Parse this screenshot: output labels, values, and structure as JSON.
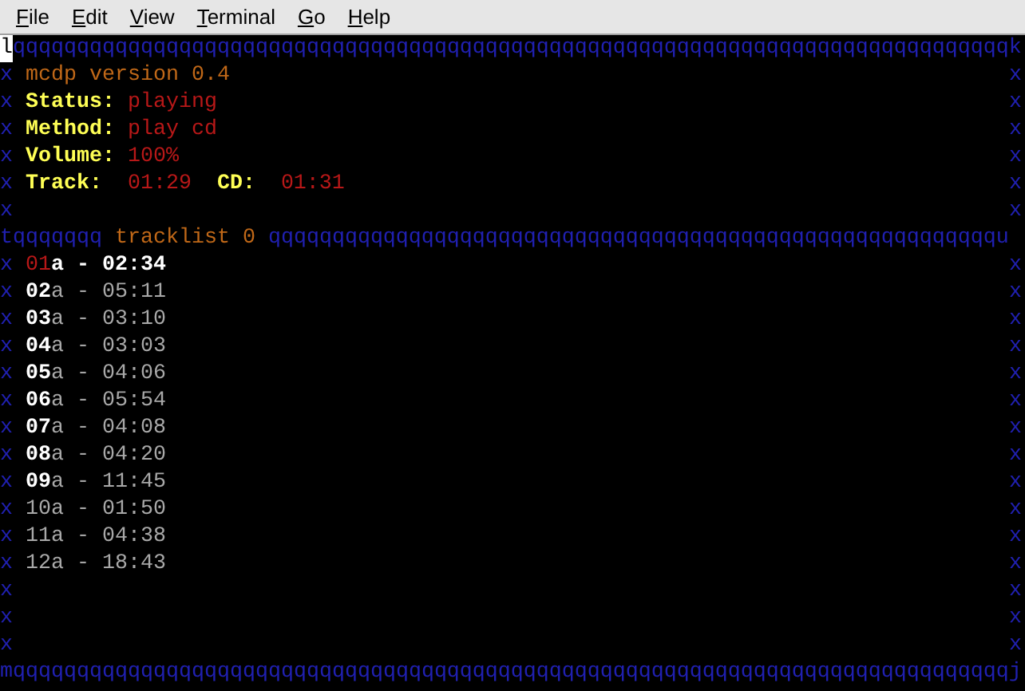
{
  "menu": [
    {
      "label": "File"
    },
    {
      "label": "Edit"
    },
    {
      "label": "View"
    },
    {
      "label": "Terminal"
    },
    {
      "label": "Go"
    },
    {
      "label": "Help"
    }
  ],
  "terminal": {
    "cursor_on_corner": true,
    "top_border": "lqqqqqqqqqqqqqqqqqqqqqqqqqqqqqqqqqqqqqqqqqqqqqqqqqqqqqqqqqqqqqqqqqqqqqqqqqqqqqqk",
    "lines": [
      {
        "kind": "title",
        "left": "x",
        "text": "mcdp version 0.4",
        "right": "x"
      },
      {
        "kind": "field",
        "left": "x",
        "label": "Status:",
        "value": "playing",
        "right": "x"
      },
      {
        "kind": "field",
        "left": "x",
        "label": "Method:",
        "value": "play cd",
        "right": "x"
      },
      {
        "kind": "field",
        "left": "x",
        "label": "Volume:",
        "value": "100%",
        "right": "x"
      },
      {
        "kind": "times",
        "left": "x",
        "label": "Track:",
        "value": "01:29",
        "label2": "CD:",
        "value2": "01:31",
        "right": "x"
      },
      {
        "kind": "blank",
        "left": "x",
        "right": "x"
      },
      {
        "kind": "divider",
        "lead": "tqqqqqqq",
        "text": "tracklist 0",
        "trail": "qqqqqqqqqqqqqqqqqqqqqqqqqqqqqqqqqqqqqqqqqqqqqqqqqqqqqqqqqu"
      },
      {
        "kind": "track",
        "left": "x",
        "number": "01",
        "suffix": "a",
        "dash": "-",
        "time": "02:34",
        "selected": true,
        "bold": false,
        "right": "x"
      },
      {
        "kind": "track",
        "left": "x",
        "number": "02",
        "suffix": "a",
        "dash": "-",
        "time": "05:11",
        "selected": false,
        "bold": true,
        "right": "x"
      },
      {
        "kind": "track",
        "left": "x",
        "number": "03",
        "suffix": "a",
        "dash": "-",
        "time": "03:10",
        "selected": false,
        "bold": true,
        "right": "x"
      },
      {
        "kind": "track",
        "left": "x",
        "number": "04",
        "suffix": "a",
        "dash": "-",
        "time": "03:03",
        "selected": false,
        "bold": true,
        "right": "x"
      },
      {
        "kind": "track",
        "left": "x",
        "number": "05",
        "suffix": "a",
        "dash": "-",
        "time": "04:06",
        "selected": false,
        "bold": true,
        "right": "x"
      },
      {
        "kind": "track",
        "left": "x",
        "number": "06",
        "suffix": "a",
        "dash": "-",
        "time": "05:54",
        "selected": false,
        "bold": true,
        "right": "x"
      },
      {
        "kind": "track",
        "left": "x",
        "number": "07",
        "suffix": "a",
        "dash": "-",
        "time": "04:08",
        "selected": false,
        "bold": true,
        "right": "x"
      },
      {
        "kind": "track",
        "left": "x",
        "number": "08",
        "suffix": "a",
        "dash": "-",
        "time": "04:20",
        "selected": false,
        "bold": true,
        "right": "x"
      },
      {
        "kind": "track",
        "left": "x",
        "number": "09",
        "suffix": "a",
        "dash": "-",
        "time": "11:45",
        "selected": false,
        "bold": true,
        "right": "x"
      },
      {
        "kind": "track",
        "left": "x",
        "number": "10",
        "suffix": "a",
        "dash": "-",
        "time": "01:50",
        "selected": false,
        "bold": false,
        "right": "x"
      },
      {
        "kind": "track",
        "left": "x",
        "number": "11",
        "suffix": "a",
        "dash": "-",
        "time": "04:38",
        "selected": false,
        "bold": false,
        "right": "x"
      },
      {
        "kind": "track",
        "left": "x",
        "number": "12",
        "suffix": "a",
        "dash": "-",
        "time": "18:43",
        "selected": false,
        "bold": false,
        "right": "x"
      },
      {
        "kind": "blank",
        "left": "x",
        "right": "x"
      },
      {
        "kind": "blank",
        "left": "x",
        "right": "x"
      },
      {
        "kind": "blank",
        "left": "x",
        "right": "x"
      }
    ],
    "bottom_border": "mqqqqqqqqqqqqqqqqqqqqqqqqqqqqqqqqqqqqqqqqqqqqqqqqqqqqqqqqqqqqqqqqqqqqqqqqqqqqqqj"
  }
}
